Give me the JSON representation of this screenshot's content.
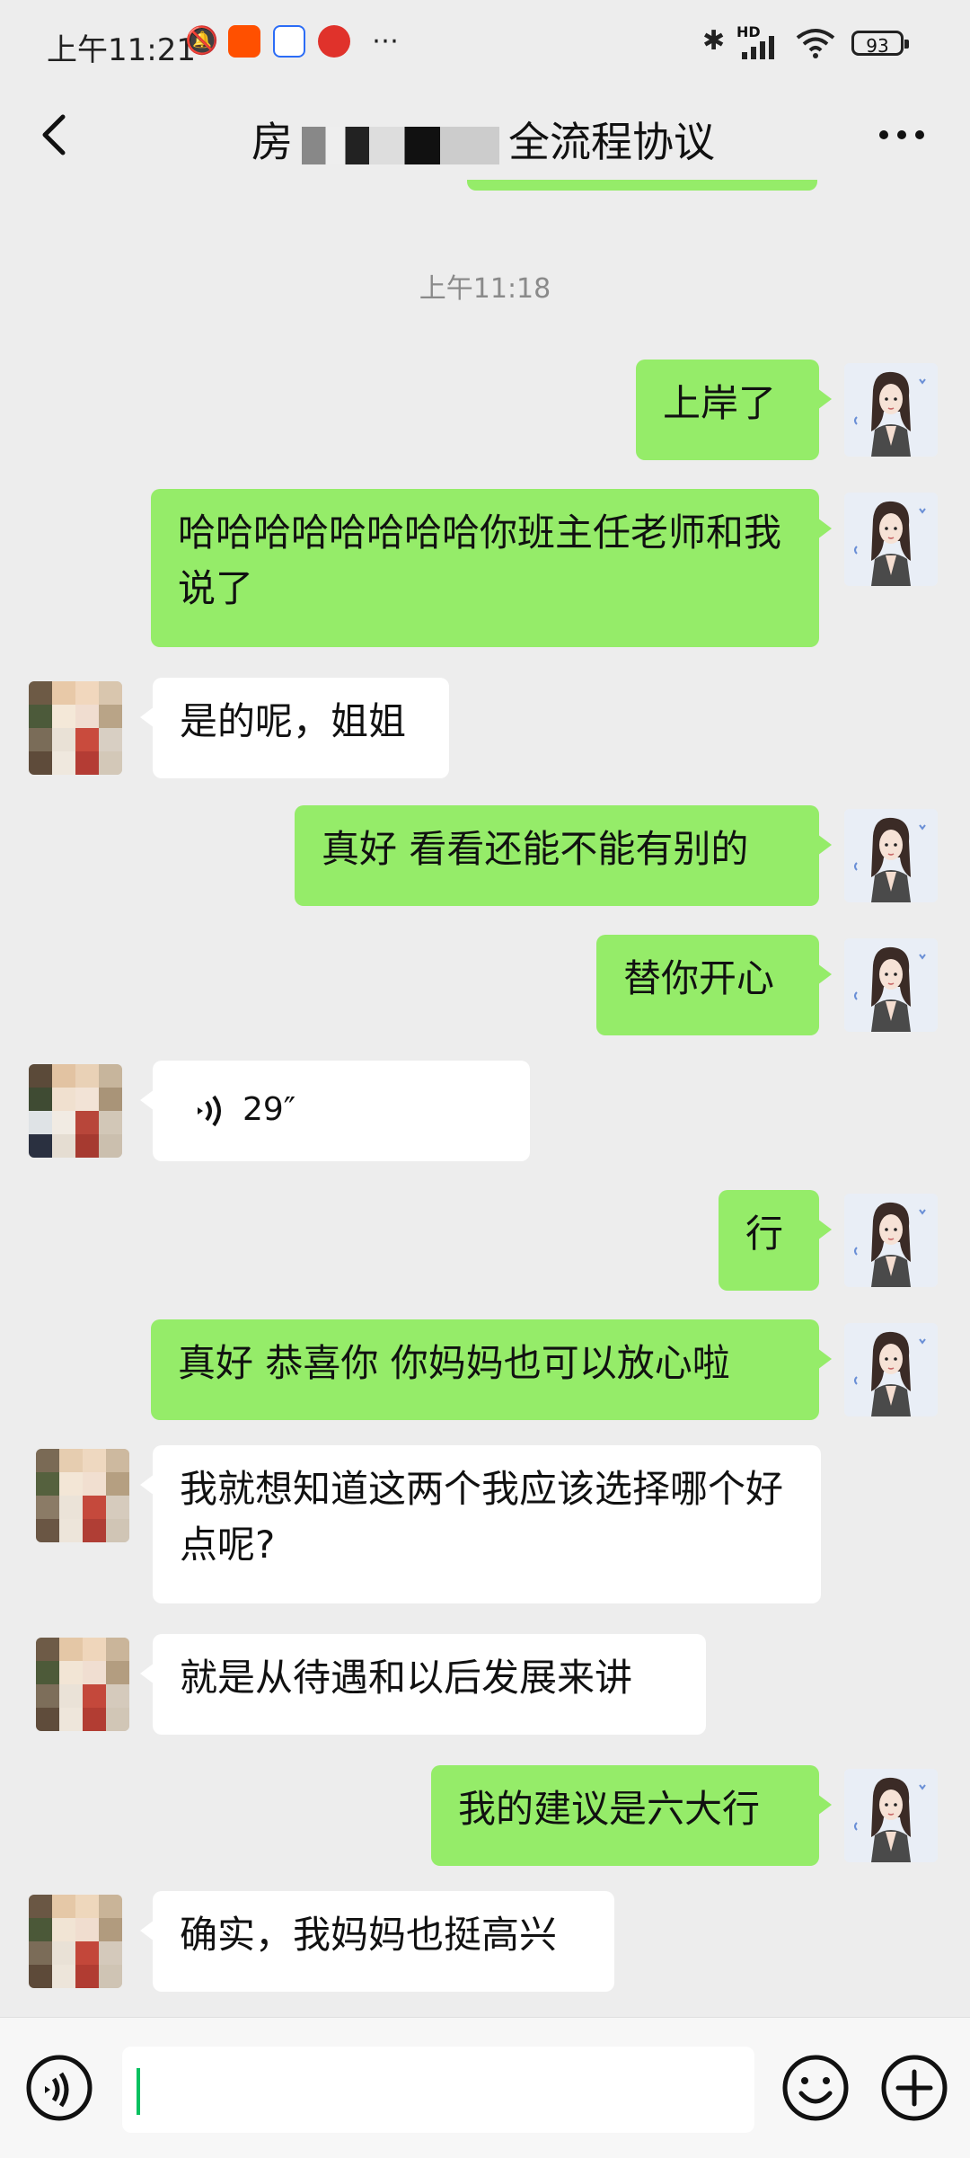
{
  "status_bar": {
    "time": "上午11:21",
    "signal_label": "HD",
    "battery": "93"
  },
  "header": {
    "title_left": "房",
    "title_right": "全流程协议"
  },
  "timestamp": "上午11:18",
  "messages": [
    {
      "from": "me",
      "text": "上岸了"
    },
    {
      "from": "me",
      "text": "哈哈哈哈哈哈哈哈你班主任老师和我说了"
    },
    {
      "from": "other",
      "text": "是的呢，姐姐"
    },
    {
      "from": "me",
      "text": "真好 看看还能不能有别的"
    },
    {
      "from": "me",
      "text": "替你开心"
    },
    {
      "from": "other",
      "type": "voice",
      "duration": "29″"
    },
    {
      "from": "me",
      "text": "行"
    },
    {
      "from": "me",
      "text": "真好 恭喜你 你妈妈也可以放心啦"
    },
    {
      "from": "other",
      "text": "我就想知道这两个我应该选择哪个好点呢?"
    },
    {
      "from": "other",
      "text": "就是从待遇和以后发展来讲"
    },
    {
      "from": "me",
      "text": "我的建议是六大行"
    },
    {
      "from": "other",
      "text": "确实，我妈妈也挺高兴"
    }
  ],
  "input": {
    "value": ""
  }
}
